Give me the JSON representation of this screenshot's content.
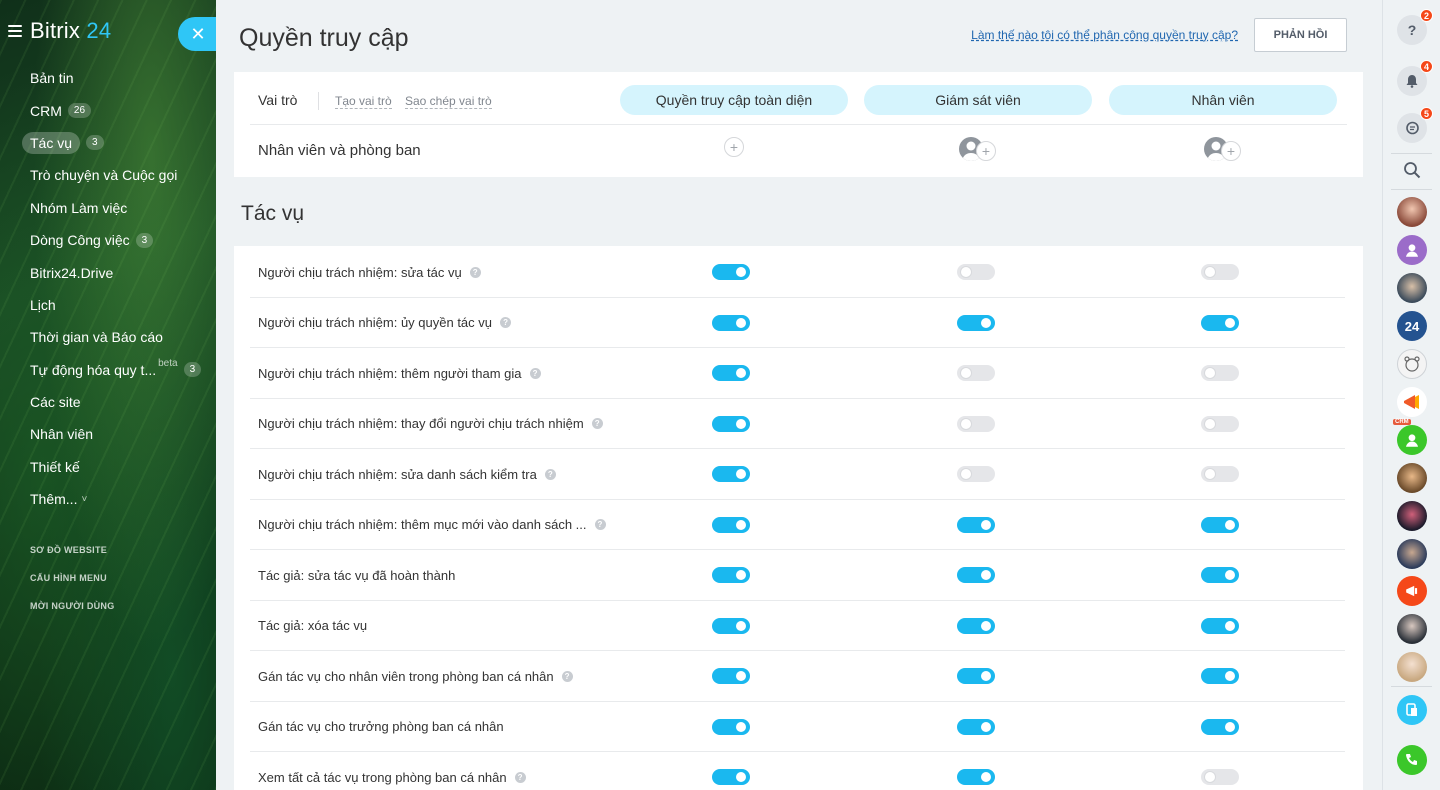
{
  "app": {
    "logo_name": "Bitrix",
    "logo_number": "24"
  },
  "sidebar": {
    "items": [
      {
        "label": "Bản tin",
        "counter": null,
        "active": false
      },
      {
        "label": "CRM",
        "counter": "26",
        "active": false
      },
      {
        "label": "Tác vụ",
        "counter": "3",
        "active": true
      },
      {
        "label": "Trò chuyện và Cuộc gọi",
        "counter": null,
        "active": false
      },
      {
        "label": "Nhóm Làm việc",
        "counter": null,
        "active": false
      },
      {
        "label": "Dòng Công việc",
        "counter": "3",
        "active": false
      },
      {
        "label": "Bitrix24.Drive",
        "counter": null,
        "active": false
      },
      {
        "label": "Lịch",
        "counter": null,
        "active": false
      },
      {
        "label": "Thời gian và Báo cáo",
        "counter": null,
        "active": false
      },
      {
        "label": "Tự động hóa quy t...",
        "counter": "3",
        "active": false,
        "beta": "beta"
      },
      {
        "label": "Các site",
        "counter": null,
        "active": false
      },
      {
        "label": "Nhân viên",
        "counter": null,
        "active": false
      },
      {
        "label": "Thiết kế",
        "counter": null,
        "active": false
      },
      {
        "label": "Thêm...",
        "counter": null,
        "active": false,
        "caret": "˅"
      }
    ],
    "links": [
      "SƠ ĐỒ WEBSITE",
      "CẤU HÌNH MENU",
      "MỜI NGƯỜI DÙNG"
    ],
    "close_symbol": "✕"
  },
  "header": {
    "title": "Quyền truy cập",
    "help_link": "Làm thế nào tôi có thể phân công quyền truy cập?",
    "feedback_button": "PHẢN HỒI"
  },
  "roles": {
    "label": "Vai trò",
    "create_role": "Tạo vai trò",
    "copy_role": "Sao chép vai trò",
    "columns": [
      "Quyền truy cập toàn diện",
      "Giám sát viên",
      "Nhân viên"
    ],
    "members_label": "Nhân viên và phòng ban",
    "add_symbol": "+"
  },
  "section": {
    "title": "Tác vụ"
  },
  "permissions": [
    {
      "label": "Người chịu trách nhiệm: sửa tác vụ",
      "help": true,
      "values": [
        true,
        false,
        false
      ]
    },
    {
      "label": "Người chịu trách nhiệm: ủy quyền tác vụ",
      "help": true,
      "values": [
        true,
        true,
        true
      ]
    },
    {
      "label": "Người chịu trách nhiệm: thêm người tham gia",
      "help": true,
      "values": [
        true,
        false,
        false
      ]
    },
    {
      "label": "Người chịu trách nhiệm: thay đổi người chịu trách nhiệm",
      "help": true,
      "values": [
        true,
        false,
        false
      ]
    },
    {
      "label": "Người chịu trách nhiệm: sửa danh sách kiểm tra",
      "help": true,
      "values": [
        true,
        false,
        false
      ]
    },
    {
      "label": "Người chịu trách nhiệm: thêm mục mới vào danh sách ...",
      "help": true,
      "values": [
        true,
        true,
        true
      ]
    },
    {
      "label": "Tác giả: sửa tác vụ đã hoàn thành",
      "help": false,
      "values": [
        true,
        true,
        true
      ]
    },
    {
      "label": "Tác giả: xóa tác vụ",
      "help": false,
      "values": [
        true,
        true,
        true
      ]
    },
    {
      "label": "Gán tác vụ cho nhân viên trong phòng ban cá nhân",
      "help": true,
      "values": [
        true,
        true,
        true
      ]
    },
    {
      "label": "Gán tác vụ cho trưởng phòng ban cá nhân",
      "help": false,
      "values": [
        true,
        true,
        true
      ]
    },
    {
      "label": "Xem tất cả tác vụ trong phòng ban cá nhân",
      "help": true,
      "values": [
        true,
        true,
        false
      ]
    }
  ],
  "help_symbol": "?",
  "rightbar": {
    "help_badge": "2",
    "notifications_badge": "4",
    "chat_badge": "5",
    "crm_tag": "CRM",
    "bitrix_avatar": "24",
    "help_symbol": "?",
    "bell_symbol": "🔔",
    "chat_symbol": "💬",
    "search_symbol": "⌕",
    "phone_symbol": "✆"
  },
  "colors": {
    "accent": "#2fc6f6",
    "toggle_on": "#1ab8ef",
    "role_pill": "#d5f4fd",
    "badge": "#f54819"
  }
}
